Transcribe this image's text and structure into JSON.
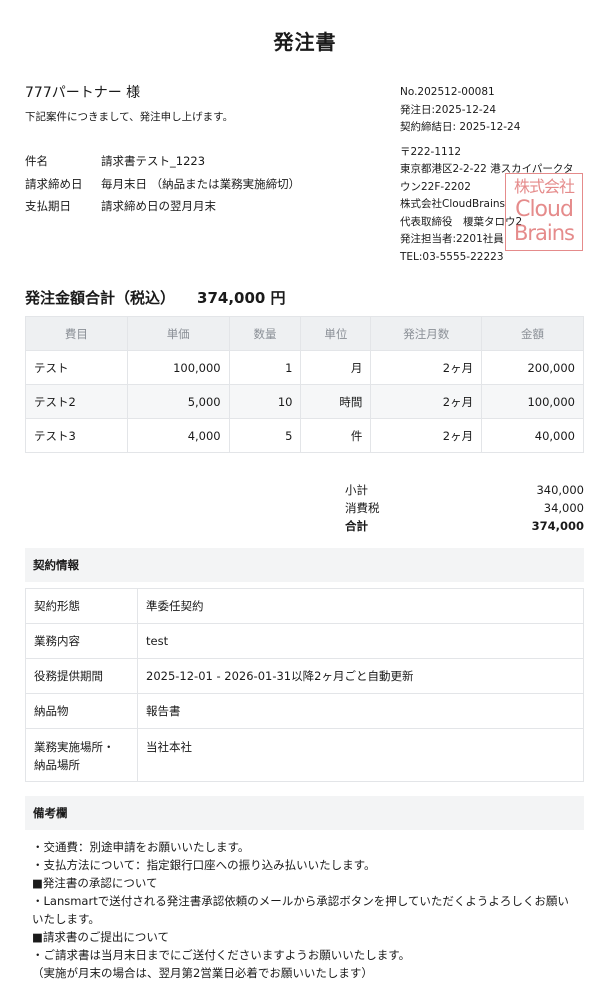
{
  "title": "発注書",
  "partner": "777パートナー 様",
  "intro": "下記案件につきまして、発注申し上げます。",
  "meta": [
    {
      "label": "件名",
      "value": "請求書テスト_1223"
    },
    {
      "label": "請求締め日",
      "value": "毎月末日 （納品または業務実施締切）"
    },
    {
      "label": "支払期日",
      "value": "請求締め日の翌月月末"
    }
  ],
  "issuer": {
    "number": "No.202512-00081",
    "order_date": "発注日:2025-12-24",
    "contract_date": "契約締結日: 2025-12-24",
    "postal": "〒222-1112",
    "address1": "東京都港区2-2-22 港スカイパークタ",
    "address2": "ウン22F-2202",
    "company": "株式会社CloudBrains",
    "representative": "代表取締役　榎葉タロウ2",
    "contact": "発注担当者:2201社員",
    "tel": "TEL:03-5555-22223"
  },
  "seal": {
    "line1": "株式会社",
    "line2": "Cloud",
    "line3": "Brains",
    "color": "#dc6464"
  },
  "total": {
    "label": "発注金額合計（税込）",
    "amount": "374,000 円"
  },
  "items_table": {
    "headers": [
      "費目",
      "単価",
      "数量",
      "単位",
      "発注月数",
      "金額"
    ],
    "rows": [
      {
        "name": "テスト",
        "unit_price": "100,000",
        "qty": "1",
        "unit": "月",
        "months": "2ヶ月",
        "amount": "200,000"
      },
      {
        "name": "テスト2",
        "unit_price": "5,000",
        "qty": "10",
        "unit": "時間",
        "months": "2ヶ月",
        "amount": "100,000"
      },
      {
        "name": "テスト3",
        "unit_price": "4,000",
        "qty": "5",
        "unit": "件",
        "months": "2ヶ月",
        "amount": "40,000"
      }
    ]
  },
  "summary": {
    "subtotal_label": "小計",
    "subtotal": "340,000",
    "tax_label": "消費税",
    "tax": "34,000",
    "total_label": "合計",
    "total": "374,000"
  },
  "contract": {
    "heading": "契約情報",
    "rows": [
      {
        "label": "契約形態",
        "value": "準委任契約"
      },
      {
        "label": "業務内容",
        "value": "test"
      },
      {
        "label": "役務提供期間",
        "value": "2025-12-01 - 2026-01-31以降2ヶ月ごと自動更新"
      },
      {
        "label": "納品物",
        "value": "報告書"
      },
      {
        "label_line1": "業務実施場所・",
        "label_line2": "納品場所",
        "value": "当社本社"
      }
    ]
  },
  "remarks": {
    "heading": "備考欄",
    "lines": [
      "・交通費：別途申請をお願いいたします。",
      "・支払方法について：指定銀行口座への振り込み払いいたします。",
      "■発注書の承認について",
      "・Lansmartで送付される発注書承認依頼のメールから承認ボタンを押していただくようよろしくお願いいたします。",
      "■請求書のご提出について",
      "・ご請求書は当月末日までにご送付くださいますようお願いいたします。",
      "（実施が月末の場合は、翌月第2営業日必着でお願いいたします）"
    ]
  }
}
